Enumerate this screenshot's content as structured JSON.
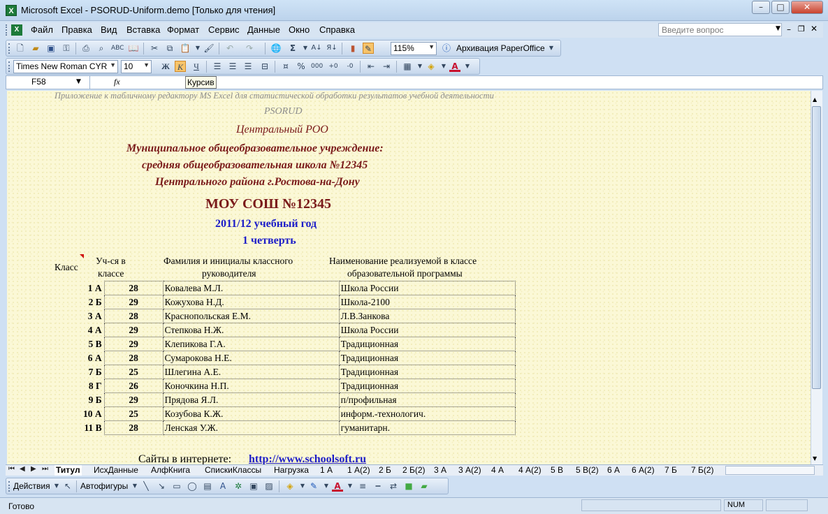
{
  "window": {
    "title": "Microsoft Excel - PSORUD-Uniform.demo  [Только для чтения]",
    "icon": "excel-icon"
  },
  "menu": {
    "items": [
      "Файл",
      "Правка",
      "Вид",
      "Вставка",
      "Формат",
      "Сервис",
      "Данные",
      "Окно",
      "Справка"
    ],
    "help_placeholder": "Введите вопрос"
  },
  "toolbar_standard": {
    "zoom": "115%",
    "archive_label": "Архивация PaperOffice"
  },
  "toolbar_format": {
    "font": "Times New Roman CYR",
    "size": "10"
  },
  "formula_bar": {
    "cell": "F58",
    "fx": "fx",
    "tooltip": "Курсив"
  },
  "sheet": {
    "note": "Приложение к табличному редактору MS Excel для статистической обработки  результатов учебной деятельности",
    "program": "PSORUD",
    "district": "Центральный РОО",
    "institution_line1": "Муниципальное общеобразовательное учреждение:",
    "institution_line2": "средняя общеобразовательная школа  №12345",
    "institution_line3": "Центрального района г.Ростова-на-Дону",
    "school": "МОУ СОШ  №12345",
    "year": "2011/12 учебный год",
    "quarter": "1 четверть",
    "headers": {
      "class": "Класс",
      "students_1": "Уч-ся в",
      "students_2": "классе",
      "teacher_1": "Фамилия и инициалы классного",
      "teacher_2": "руководителя",
      "program_1": "Наименование реализуемой в классе",
      "program_2": "образовательной программы"
    },
    "rows": [
      {
        "class": "1 А",
        "count": "28",
        "teacher": "Ковалева М.Л.",
        "program": "Школа России"
      },
      {
        "class": "2 Б",
        "count": "29",
        "teacher": "Кожухова Н.Д.",
        "program": "Школа-2100"
      },
      {
        "class": "3 А",
        "count": "28",
        "teacher": "Краснопольская Е.М.",
        "program": "Л.В.Занкова"
      },
      {
        "class": "4 А",
        "count": "29",
        "teacher": "Степкова Н.Ж.",
        "program": "Школа России"
      },
      {
        "class": "5 В",
        "count": "29",
        "teacher": "Клепикова Г.А.",
        "program": "Традиционная"
      },
      {
        "class": "6 А",
        "count": "28",
        "teacher": "Сумарокова Н.Е.",
        "program": "Традиционная"
      },
      {
        "class": "7 Б",
        "count": "25",
        "teacher": "Шлегина А.Е.",
        "program": "Традиционная"
      },
      {
        "class": "8 Г",
        "count": "26",
        "teacher": "Коночкина Н.П.",
        "program": "Традиционная"
      },
      {
        "class": "9 Б",
        "count": "29",
        "teacher": "Прядова Я.Л.",
        "program": "п/профильная"
      },
      {
        "class": "10 А",
        "count": "25",
        "teacher": "Козубова К.Ж.",
        "program": "информ.-технологич."
      },
      {
        "class": "11 В",
        "count": "28",
        "teacher": "Ленская У.Ж.",
        "program": "гуманитарн."
      }
    ],
    "sites_label": "Сайты в интернете:",
    "sites_url": "http://www.schoolsoft.ru"
  },
  "tabs": [
    "Титул",
    "ИсхДанные",
    "АлфКнига",
    "СпискиКлассы",
    "Нагрузка",
    "1 А",
    "1 А(2)",
    "2 Б",
    "2 Б(2)",
    "3 А",
    "3 А(2)",
    "4 А",
    "4 А(2)",
    "5 В",
    "5 В(2)",
    "6 А",
    "6 А(2)",
    "7 Б",
    "7 Б(2)"
  ],
  "drawing": {
    "actions": "Действия",
    "autoshapes": "Автофигуры"
  },
  "status": {
    "ready": "Готово",
    "num": "NUM"
  }
}
